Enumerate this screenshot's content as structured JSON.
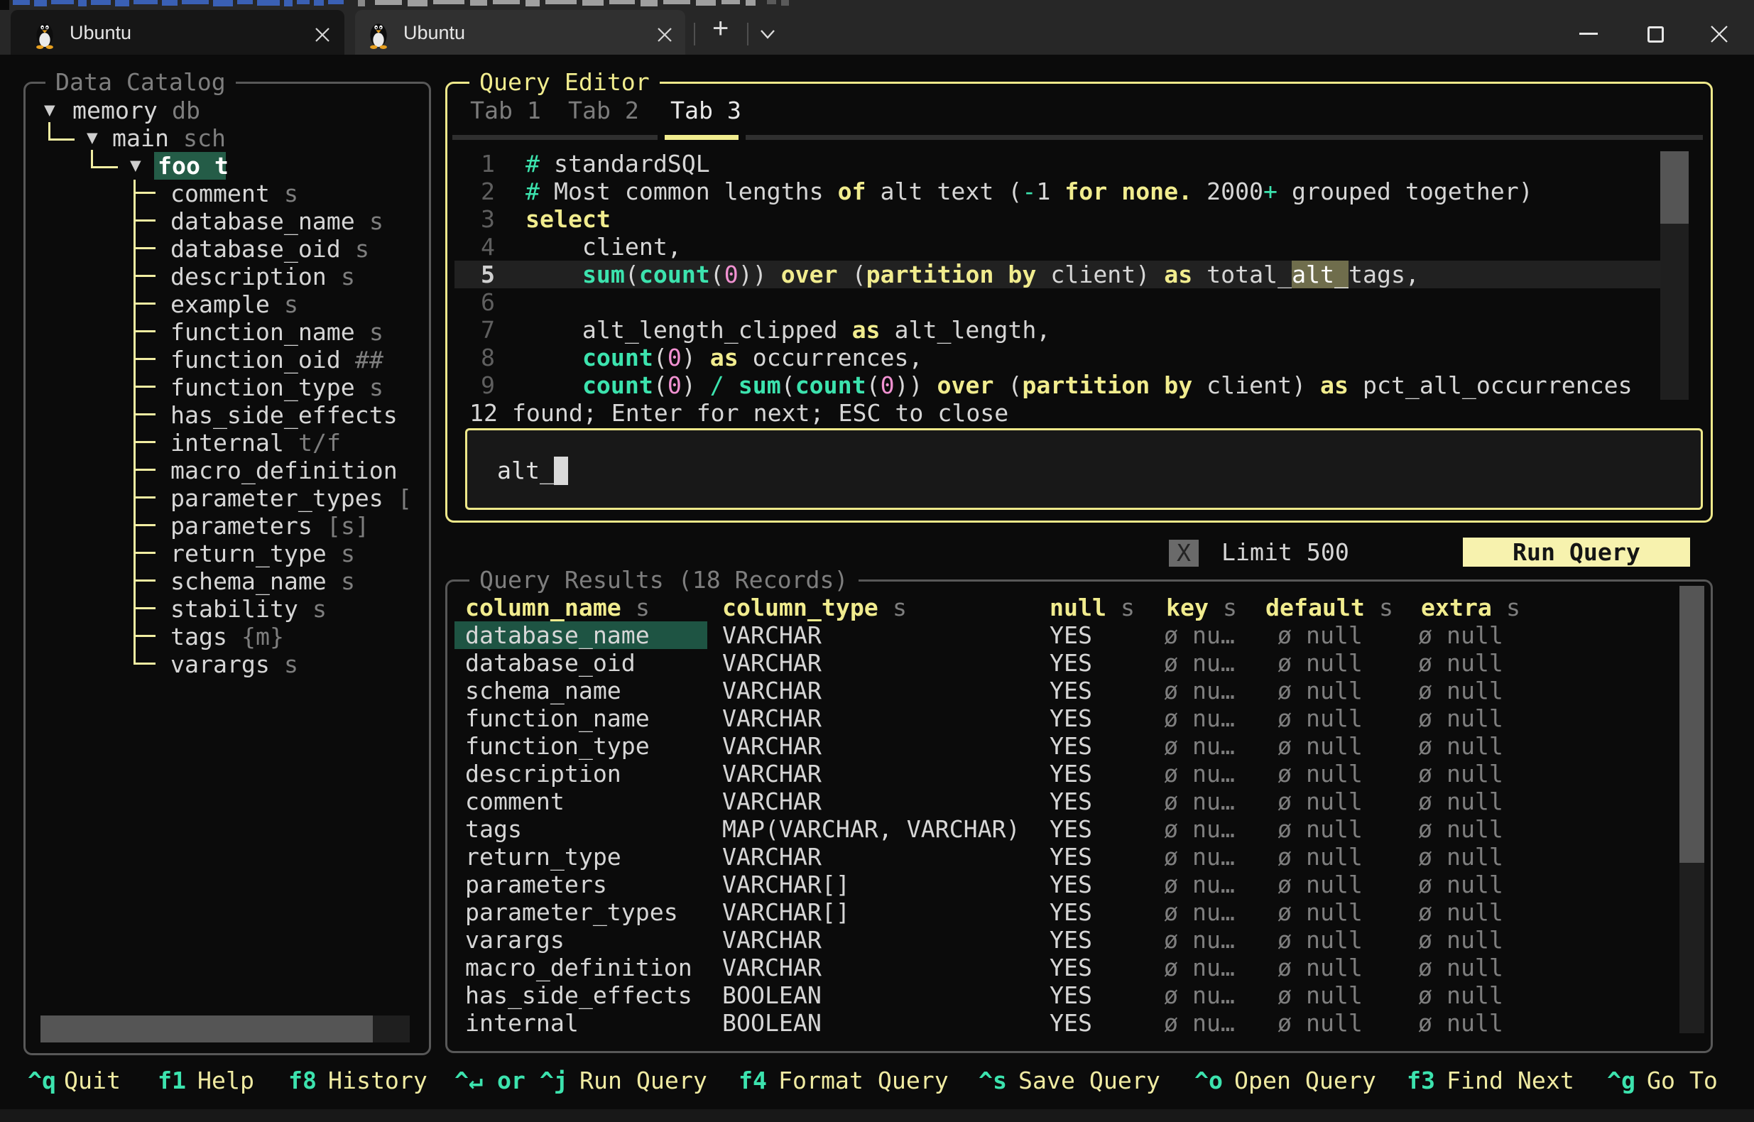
{
  "window": {
    "tabs": [
      {
        "title": "Ubuntu"
      },
      {
        "title": "Ubuntu"
      }
    ],
    "new_tab_label": "+",
    "controls": {
      "minimize": "minimize",
      "maximize": "maximize",
      "close": "close"
    }
  },
  "catalog": {
    "title": "Data Catalog",
    "tree": [
      {
        "label": "memory",
        "suffix": "db",
        "depth": 0,
        "expanded": true
      },
      {
        "label": "main",
        "suffix": "sch",
        "depth": 1,
        "expanded": true
      },
      {
        "label": "foo",
        "suffix": "t",
        "depth": 2,
        "expanded": true,
        "selected": true
      },
      {
        "label": "comment",
        "suffix": "s",
        "depth": 3
      },
      {
        "label": "database_name",
        "suffix": "s",
        "depth": 3
      },
      {
        "label": "database_oid",
        "suffix": "s",
        "depth": 3
      },
      {
        "label": "description",
        "suffix": "s",
        "depth": 3
      },
      {
        "label": "example",
        "suffix": "s",
        "depth": 3
      },
      {
        "label": "function_name",
        "suffix": "s",
        "depth": 3
      },
      {
        "label": "function_oid",
        "suffix": "##",
        "depth": 3
      },
      {
        "label": "function_type",
        "suffix": "s",
        "depth": 3
      },
      {
        "label": "has_side_effects",
        "suffix": "",
        "depth": 3
      },
      {
        "label": "internal",
        "suffix": "t/f",
        "depth": 3
      },
      {
        "label": "macro_definition",
        "suffix": "",
        "depth": 3
      },
      {
        "label": "parameter_types",
        "suffix": "[",
        "depth": 3
      },
      {
        "label": "parameters",
        "suffix": "[s]",
        "depth": 3
      },
      {
        "label": "return_type",
        "suffix": "s",
        "depth": 3
      },
      {
        "label": "schema_name",
        "suffix": "s",
        "depth": 3
      },
      {
        "label": "stability",
        "suffix": "s",
        "depth": 3
      },
      {
        "label": "tags",
        "suffix": "{m}",
        "depth": 3
      },
      {
        "label": "varargs",
        "suffix": "s",
        "depth": 3
      }
    ]
  },
  "editor": {
    "title": "Query Editor",
    "tabs": [
      "Tab 1",
      "Tab 2",
      "Tab 3"
    ],
    "active_tab_index": 2,
    "lines": [
      {
        "num": "1",
        "tokens": [
          [
            "#",
            "cm"
          ],
          [
            " standardSQL",
            "fg"
          ]
        ]
      },
      {
        "num": "2",
        "tokens": [
          [
            "#",
            "cm"
          ],
          [
            " Most common lengths ",
            "fg"
          ],
          [
            "of",
            "kw"
          ],
          [
            " alt text (",
            "fg"
          ],
          [
            "-",
            "op"
          ],
          [
            "1 ",
            "fg"
          ],
          [
            "for none.",
            "kw"
          ],
          [
            " 2000",
            "fg"
          ],
          [
            "+",
            "op"
          ],
          [
            " grouped together)",
            "fg"
          ]
        ]
      },
      {
        "num": "3",
        "tokens": [
          [
            "select",
            "kw"
          ]
        ]
      },
      {
        "num": "4",
        "tokens": [
          [
            "    client,",
            "fg"
          ]
        ]
      },
      {
        "num": "5",
        "highlight": true,
        "tokens": [
          [
            "    ",
            "fg"
          ],
          [
            "sum",
            "fn"
          ],
          [
            "(",
            "fg"
          ],
          [
            "count",
            "fn"
          ],
          [
            "(",
            "fg"
          ],
          [
            "0",
            "num"
          ],
          [
            ")) ",
            "fg"
          ],
          [
            "over",
            "kw"
          ],
          [
            " (",
            "fg"
          ],
          [
            "partition",
            "kw"
          ],
          [
            " ",
            "fg"
          ],
          [
            "by",
            "kw"
          ],
          [
            " client) ",
            "fg"
          ],
          [
            "as",
            "kw"
          ],
          [
            " total_",
            "fg"
          ],
          [
            "alt_",
            "find"
          ],
          [
            "tags,",
            "fg"
          ]
        ]
      },
      {
        "num": "6",
        "tokens": []
      },
      {
        "num": "7",
        "tokens": [
          [
            "    alt_length_clipped ",
            "fg"
          ],
          [
            "as",
            "kw"
          ],
          [
            " alt_length,",
            "fg"
          ]
        ]
      },
      {
        "num": "8",
        "tokens": [
          [
            "    ",
            "fg"
          ],
          [
            "count",
            "fn"
          ],
          [
            "(",
            "fg"
          ],
          [
            "0",
            "num"
          ],
          [
            ") ",
            "fg"
          ],
          [
            "as",
            "kw"
          ],
          [
            " occurrences,",
            "fg"
          ]
        ]
      },
      {
        "num": "9",
        "tokens": [
          [
            "    ",
            "fg"
          ],
          [
            "count",
            "fn"
          ],
          [
            "(",
            "fg"
          ],
          [
            "0",
            "num"
          ],
          [
            ") ",
            "fg"
          ],
          [
            "/",
            "op"
          ],
          [
            " ",
            "fg"
          ],
          [
            "sum",
            "fn"
          ],
          [
            "(",
            "fg"
          ],
          [
            "count",
            "fn"
          ],
          [
            "(",
            "fg"
          ],
          [
            "0",
            "num"
          ],
          [
            ")) ",
            "fg"
          ],
          [
            "over",
            "kw"
          ],
          [
            " (",
            "fg"
          ],
          [
            "partition",
            "kw"
          ],
          [
            " ",
            "fg"
          ],
          [
            "by",
            "kw"
          ],
          [
            " client) ",
            "fg"
          ],
          [
            "as",
            "kw"
          ],
          [
            " pct_all_occurrences",
            "fg"
          ]
        ]
      }
    ],
    "find_status": "12 found; Enter for next; ESC to close",
    "search_value": "alt_"
  },
  "run_bar": {
    "limit_checkbox": "X",
    "limit_label": "Limit 500",
    "run_button": "Run Query"
  },
  "results": {
    "title": "Query Results (18 Records)",
    "headers": [
      {
        "label": "column_name",
        "suffix": "s"
      },
      {
        "label": "column_type",
        "suffix": "s"
      },
      {
        "label": "null",
        "suffix": "s"
      },
      {
        "label": "key",
        "suffix": "s"
      },
      {
        "label": "default",
        "suffix": "s"
      },
      {
        "label": "extra",
        "suffix": "s"
      }
    ],
    "rows": [
      {
        "column_name": "database_name",
        "column_type": "VARCHAR",
        "null": "YES",
        "key": "ø nu…",
        "default": "ø null",
        "extra": "ø null",
        "selected": true
      },
      {
        "column_name": "database_oid",
        "column_type": "VARCHAR",
        "null": "YES",
        "key": "ø nu…",
        "default": "ø null",
        "extra": "ø null"
      },
      {
        "column_name": "schema_name",
        "column_type": "VARCHAR",
        "null": "YES",
        "key": "ø nu…",
        "default": "ø null",
        "extra": "ø null"
      },
      {
        "column_name": "function_name",
        "column_type": "VARCHAR",
        "null": "YES",
        "key": "ø nu…",
        "default": "ø null",
        "extra": "ø null"
      },
      {
        "column_name": "function_type",
        "column_type": "VARCHAR",
        "null": "YES",
        "key": "ø nu…",
        "default": "ø null",
        "extra": "ø null"
      },
      {
        "column_name": "description",
        "column_type": "VARCHAR",
        "null": "YES",
        "key": "ø nu…",
        "default": "ø null",
        "extra": "ø null"
      },
      {
        "column_name": "comment",
        "column_type": "VARCHAR",
        "null": "YES",
        "key": "ø nu…",
        "default": "ø null",
        "extra": "ø null"
      },
      {
        "column_name": "tags",
        "column_type": "MAP(VARCHAR, VARCHAR)",
        "null": "YES",
        "key": "ø nu…",
        "default": "ø null",
        "extra": "ø null"
      },
      {
        "column_name": "return_type",
        "column_type": "VARCHAR",
        "null": "YES",
        "key": "ø nu…",
        "default": "ø null",
        "extra": "ø null"
      },
      {
        "column_name": "parameters",
        "column_type": "VARCHAR[]",
        "null": "YES",
        "key": "ø nu…",
        "default": "ø null",
        "extra": "ø null"
      },
      {
        "column_name": "parameter_types",
        "column_type": "VARCHAR[]",
        "null": "YES",
        "key": "ø nu…",
        "default": "ø null",
        "extra": "ø null"
      },
      {
        "column_name": "varargs",
        "column_type": "VARCHAR",
        "null": "YES",
        "key": "ø nu…",
        "default": "ø null",
        "extra": "ø null"
      },
      {
        "column_name": "macro_definition",
        "column_type": "VARCHAR",
        "null": "YES",
        "key": "ø nu…",
        "default": "ø null",
        "extra": "ø null"
      },
      {
        "column_name": "has_side_effects",
        "column_type": "BOOLEAN",
        "null": "YES",
        "key": "ø nu…",
        "default": "ø null",
        "extra": "ø null"
      },
      {
        "column_name": "internal",
        "column_type": "BOOLEAN",
        "null": "YES",
        "key": "ø nu…",
        "default": "ø null",
        "extra": "ø null"
      }
    ]
  },
  "footer": [
    {
      "key": "^q",
      "label": "Quit"
    },
    {
      "key": "f1",
      "label": "Help"
    },
    {
      "key": "f8",
      "label": "History"
    },
    {
      "key": "^↵ or ^j",
      "label": "Run Query"
    },
    {
      "key": "f4",
      "label": "Format Query"
    },
    {
      "key": "^s",
      "label": "Save Query"
    },
    {
      "key": "^o",
      "label": "Open Query"
    },
    {
      "key": "f3",
      "label": "Find Next"
    },
    {
      "key": "^g",
      "label": "Go To"
    }
  ],
  "colors": {
    "bg": "#0b0b0b",
    "chrome": "#272727",
    "tabActive": "#161616",
    "tabInactive": "#303030",
    "fg": "#d6d6d6",
    "dim": "#7e7e7e",
    "border": "#585858",
    "yellow": "#f1ec8e",
    "yellowBorder": "#eee88a",
    "button": "#f7f2ae",
    "teal": "#3ce3ae",
    "pink": "#f191d1",
    "selGreen": "#245c47",
    "rowSel": "#1e5443",
    "find": "#6f6d4c",
    "rowHl": "#212121",
    "scrollThumb": "#555555",
    "scrollTrack": "#1f1f1f",
    "cursor": "#d9d9d9",
    "linenum": "#5f5f5f",
    "guide": "#f1eda2",
    "titleDim": "#8f8f8f"
  }
}
